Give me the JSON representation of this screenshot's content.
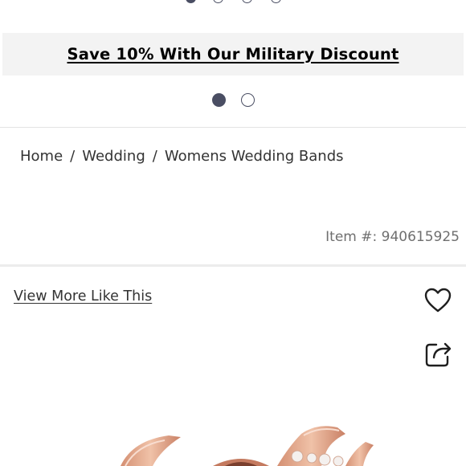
{
  "carousel_top": {
    "dot_count": 4,
    "active_index": 0
  },
  "promo": {
    "text": "Save 10% With Our Military Discount"
  },
  "carousel": {
    "dot_count": 2,
    "active_index": 0
  },
  "breadcrumb": {
    "items": [
      "Home",
      "Wedding",
      "Womens Wedding Bands"
    ],
    "separator": "/"
  },
  "product": {
    "item_number": "Item #: 940615925",
    "view_more_label": "View More Like This"
  },
  "icons": {
    "wishlist": "heart-icon",
    "share": "share-icon"
  },
  "colors": {
    "dot": "#4a4e63",
    "promo_bg": "#f3f3f3",
    "ring_metal": "#e0a58a"
  }
}
